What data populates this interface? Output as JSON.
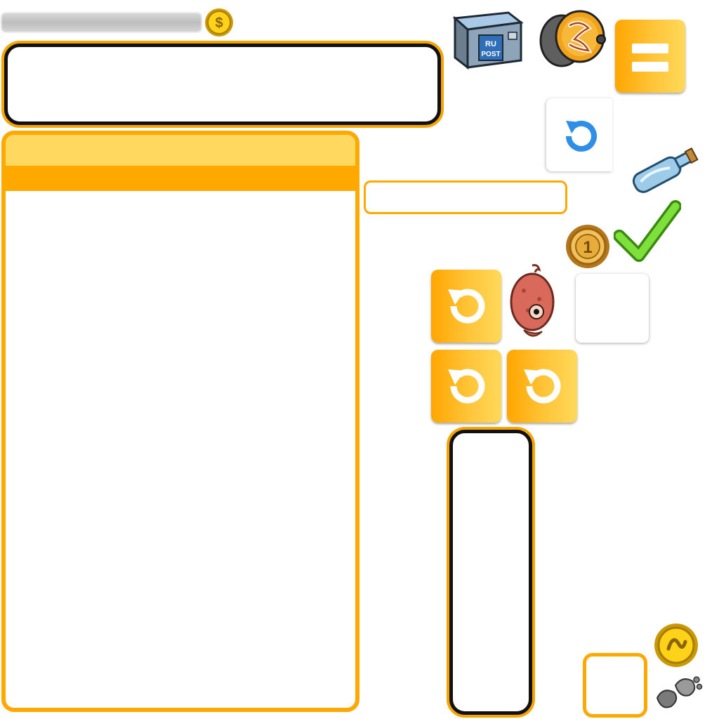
{
  "hud": {
    "progress_fill": 1.0,
    "dollar_symbol": "$",
    "coin_one_label": "1",
    "postbox_label": "RU POST",
    "coin_bonus_symbol": "$"
  },
  "colors": {
    "accent_orange": "#ffa800",
    "accent_yellow": "#ffd95a",
    "check_green": "#5fcc1c",
    "refresh_blue": "#2f8fe6",
    "panel_border": "#111111"
  },
  "icons": [
    "menu-icon",
    "refresh-icon",
    "bottle-icon",
    "check-icon",
    "coin-one-icon",
    "fish-icon",
    "rotate-icon",
    "postbox-icon",
    "pot-icon",
    "dollar-coin-icon",
    "bonus-coin-icon",
    "footprints-icon"
  ]
}
